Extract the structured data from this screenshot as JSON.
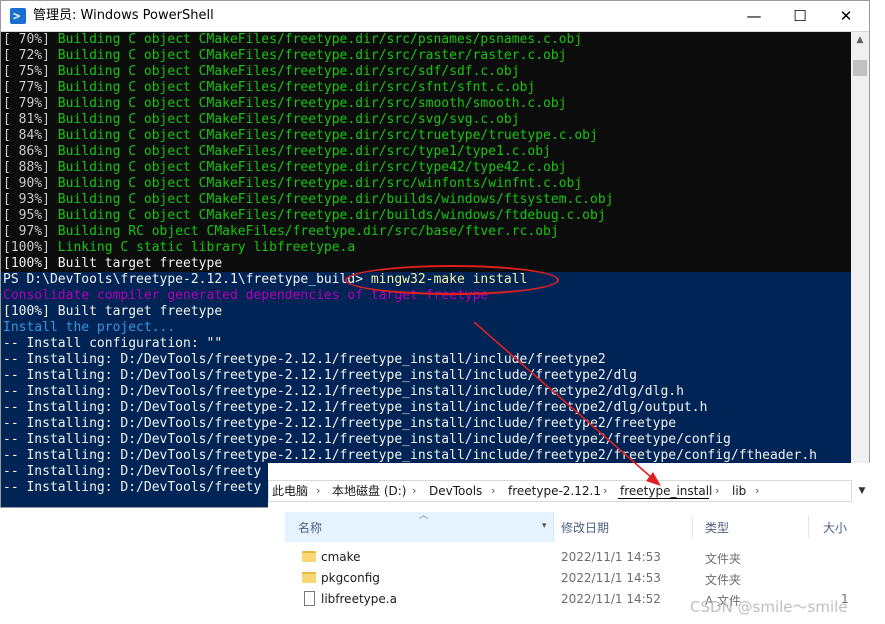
{
  "powershell": {
    "title": "管理员: Windows PowerShell",
    "controls": {
      "minimize": "—",
      "maximize": "☐",
      "close": "✕"
    },
    "build_lines": [
      {
        "pct": "[ 70%] ",
        "text": "Building C object CMakeFiles/freetype.dir/src/psnames/psnames.c.obj"
      },
      {
        "pct": "[ 72%] ",
        "text": "Building C object CMakeFiles/freetype.dir/src/raster/raster.c.obj"
      },
      {
        "pct": "[ 75%] ",
        "text": "Building C object CMakeFiles/freetype.dir/src/sdf/sdf.c.obj"
      },
      {
        "pct": "[ 77%] ",
        "text": "Building C object CMakeFiles/freetype.dir/src/sfnt/sfnt.c.obj"
      },
      {
        "pct": "[ 79%] ",
        "text": "Building C object CMakeFiles/freetype.dir/src/smooth/smooth.c.obj"
      },
      {
        "pct": "[ 81%] ",
        "text": "Building C object CMakeFiles/freetype.dir/src/svg/svg.c.obj"
      },
      {
        "pct": "[ 84%] ",
        "text": "Building C object CMakeFiles/freetype.dir/src/truetype/truetype.c.obj"
      },
      {
        "pct": "[ 86%] ",
        "text": "Building C object CMakeFiles/freetype.dir/src/type1/type1.c.obj"
      },
      {
        "pct": "[ 88%] ",
        "text": "Building C object CMakeFiles/freetype.dir/src/type42/type42.c.obj"
      },
      {
        "pct": "[ 90%] ",
        "text": "Building C object CMakeFiles/freetype.dir/src/winfonts/winfnt.c.obj"
      },
      {
        "pct": "[ 93%] ",
        "text": "Building C object CMakeFiles/freetype.dir/builds/windows/ftsystem.c.obj"
      },
      {
        "pct": "[ 95%] ",
        "text": "Building C object CMakeFiles/freetype.dir/builds/windows/ftdebug.c.obj"
      },
      {
        "pct": "[ 97%] ",
        "text": "Building RC object CMakeFiles/freetype.dir/src/base/ftver.rc.obj"
      },
      {
        "pct": "[100%] ",
        "text": "Linking C static library libfreetype.a"
      }
    ],
    "built_line": "[100%] Built target freetype",
    "prompt": "PS D:\\DevTools\\freetype-2.12.1\\freetype_build> ",
    "command": "mingw32-make install",
    "consolidate_line": "Consolidate compiler generated dependencies of target freetype",
    "built_line_2": "[100%] Built target freetype",
    "install_project": "Install the project...",
    "install_config": "-- Install configuration: \"\"",
    "install_lines": [
      "-- Installing: D:/DevTools/freetype-2.12.1/freetype_install/include/freetype2",
      "-- Installing: D:/DevTools/freetype-2.12.1/freetype_install/include/freetype2/dlg",
      "-- Installing: D:/DevTools/freetype-2.12.1/freetype_install/include/freetype2/dlg/dlg.h",
      "-- Installing: D:/DevTools/freetype-2.12.1/freetype_install/include/freetype2/dlg/output.h",
      "-- Installing: D:/DevTools/freetype-2.12.1/freetype_install/include/freetype2/freetype",
      "-- Installing: D:/DevTools/freetype-2.12.1/freetype_install/include/freetype2/freetype/config",
      "-- Installing: D:/DevTools/freetype-2.12.1/freetype_install/include/freetype2/freetype/config/ftheader.h",
      "-- Installing: D:/DevTools/freety",
      "-- Installing: D:/DevTools/freety"
    ]
  },
  "explorer": {
    "breadcrumb": [
      "此电脑",
      "本地磁盘 (D:)",
      "DevTools",
      "freetype-2.12.1",
      "freetype_install",
      "lib"
    ],
    "columns": {
      "name": "名称",
      "modified": "修改日期",
      "type": "类型",
      "size": "大小"
    },
    "files": [
      {
        "name": "cmake",
        "modified": "2022/11/1 14:53",
        "type": "文件夹",
        "size": "",
        "icon": "folder-icon"
      },
      {
        "name": "pkgconfig",
        "modified": "2022/11/1 14:53",
        "type": "文件夹",
        "size": "",
        "icon": "folder-icon"
      },
      {
        "name": "libfreetype.a",
        "modified": "2022/11/1 14:52",
        "type": "A 文件",
        "size": "1",
        "icon": "file-icon"
      }
    ]
  },
  "watermark": "CSDN @smile～smile",
  "colors": {
    "console_bg": "#0c0c0c",
    "ps_blue": "#012456",
    "build_green": "#16c60c",
    "annotation_red": "#e02020"
  }
}
